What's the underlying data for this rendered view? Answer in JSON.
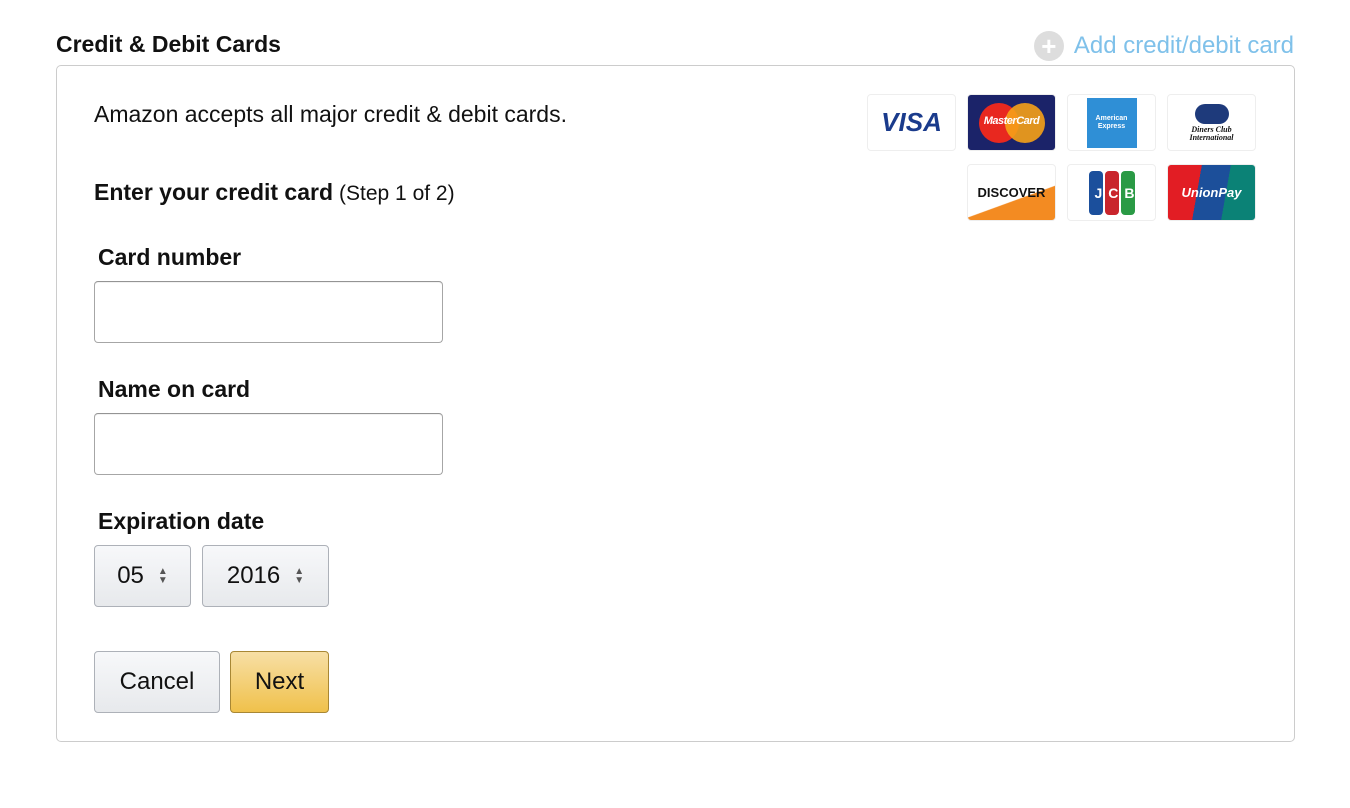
{
  "header": {
    "title": "Credit & Debit Cards",
    "add_link": "Add credit/debit card"
  },
  "form": {
    "accepts_text": "Amazon accepts all major credit & debit cards.",
    "enter_heading": "Enter your credit card",
    "step_text": "(Step 1 of 2)",
    "card_number_label": "Card number",
    "card_number_value": "",
    "name_label": "Name on card",
    "name_value": "",
    "expiration_label": "Expiration date",
    "month": "05",
    "year": "2016",
    "cancel_label": "Cancel",
    "next_label": "Next"
  },
  "card_logos": [
    "VISA",
    "MasterCard",
    "American Express",
    "Diners Club International",
    "DISCOVER",
    "JCB",
    "UnionPay"
  ],
  "colors": {
    "link": "#7fc1ea",
    "next_button": "#f0c14b"
  }
}
